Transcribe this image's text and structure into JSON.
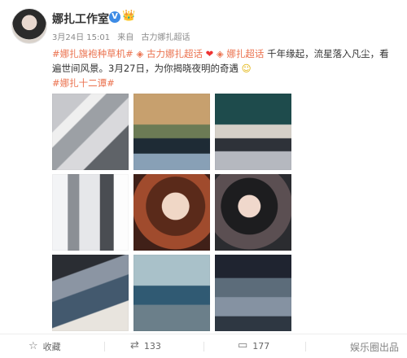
{
  "post": {
    "author": "娜扎工作室",
    "time": "3月24日 15:01",
    "source_prefix": "来自",
    "source": "古力娜扎超话",
    "text": {
      "tag1": "#娜扎旗袍种草机#",
      "super1": "古力娜扎超话",
      "super2": "娜扎超话",
      "line1": "千年缘起，流星落入凡尘，看遍世间风景。3月27日，为你揭晓夜明的奇遇",
      "tag2": "#娜扎十二谭#"
    }
  },
  "actions": {
    "collect": "收藏",
    "repost_count": "133",
    "comment_count": "",
    "like_count": "177"
  },
  "watermark": "娱乐圈出品",
  "icons": {
    "verified": "verified-icon",
    "crown": "crown-icon",
    "super_topic": "super-topic-icon",
    "heart": "heart-icon",
    "smile": "smile-icon",
    "star": "star-icon",
    "repost": "repost-icon",
    "comment": "comment-icon",
    "like": "like-icon"
  }
}
